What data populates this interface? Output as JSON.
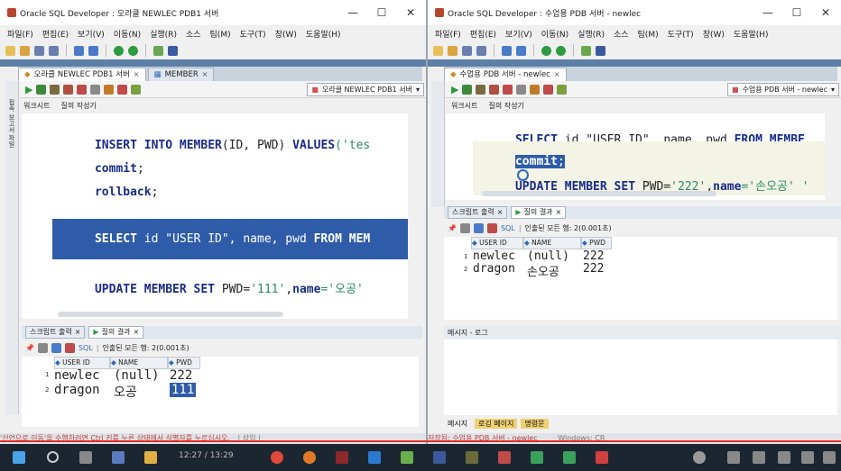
{
  "left": {
    "title": "Oracle SQL Developer : 오라클 NEWLEC PDB1 서버",
    "menu": [
      "파일(F)",
      "편집(E)",
      "보기(V)",
      "이동(N)",
      "실행(R)",
      "소스",
      "팀(M)",
      "도구(T)",
      "창(W)",
      "도움말(H)"
    ],
    "tabs": [
      "오라클 NEWLEC PDB1 서버",
      "MEMBER"
    ],
    "connection": "오라클 NEWLEC PDB1 서버",
    "subtabs": [
      "워크시트",
      "질의 작성기"
    ],
    "vtext": "접속 보고서 파일",
    "code": [
      {
        "kw": "INSERT INTO MEMBER",
        "rest": "(ID, PWD) ",
        "kw2": "VALUES",
        "str": "('tes"
      },
      {
        "kw": "commit",
        "rest": ";"
      },
      {
        "kw": "rollback",
        "rest": ";"
      },
      {
        "kw": "SELECT",
        "rest": " id \"USER ID\", name, pwd ",
        "kw2": "FROM",
        "kw3": " MEM"
      },
      {
        "kw": "UPDATE MEMBER SET",
        "rest": " PWD=",
        "str": "'111'",
        "rest2": ",",
        "kw2": "name",
        "str2": "='오공'"
      }
    ],
    "result_tabs": [
      "스크립트 출력",
      "질의 결과"
    ],
    "result_status": "인출된 모든 행: 2(0.001초)",
    "sql_label": "SQL",
    "columns": [
      "USER ID",
      "NAME",
      "PWD"
    ],
    "rows": [
      [
        "1",
        "newlec",
        "(null)",
        "222"
      ],
      [
        "2",
        "dragon",
        "오공",
        "111"
      ]
    ],
    "status": "'선언으로 이동'을 수행하려면 Ctrl 키를 누른 상태에서 식별자를 누르십시오.",
    "status2": "| 삽입 |"
  },
  "right": {
    "title": "Oracle SQL Developer : 수업용 PDB 서버 - newlec",
    "menu": [
      "파일(F)",
      "편집(E)",
      "보기(V)",
      "이동(N)",
      "실행(R)",
      "소스",
      "팀(M)",
      "도구(T)",
      "창(W)",
      "도움말(H)"
    ],
    "tabs": [
      "수업용 PDB 서버 - newlec"
    ],
    "connection": "수업용 PDB 서버 - newlec",
    "subtabs": [
      "워크시트",
      "질의 작성기"
    ],
    "code": [
      {
        "kw": "SELECT",
        "rest": " id \"USER ID\", name, pwd ",
        "kw2": "FROM",
        "kw3": " MEMBE"
      },
      {
        "kw": "commit",
        "rest": ";"
      },
      {
        "kw": "UPDATE MEMBER SET",
        "rest": " PWD=",
        "str": "'222'",
        "rest2": ",",
        "kw2": "name",
        "str2": "='손오공' '"
      }
    ],
    "result_tabs": [
      "스크립트 출력",
      "질의 결과"
    ],
    "result_status": "인출된 모든 행: 2(0.001초)",
    "sql_label": "SQL",
    "columns": [
      "USER ID",
      "NAME",
      "PWD"
    ],
    "rows": [
      [
        "1",
        "newlec",
        "(null)",
        "222"
      ],
      [
        "2",
        "dragon",
        "손오공",
        "222"
      ]
    ],
    "msg_title": "메시지 - 로그",
    "bottom_tabs": [
      "메시지",
      "로깅 페이지",
      "명령문"
    ],
    "status": "저장됨: 수업용 PDB 서버 - newlec",
    "status2": "Windows: CR"
  },
  "taskbar": {
    "clock": "12:27 / 13:29"
  },
  "colors": {
    "accent": "#2f5ca8",
    "band": "#5c7fa6",
    "keyword": "#1a2c8a",
    "string": "#2a8a6a"
  }
}
